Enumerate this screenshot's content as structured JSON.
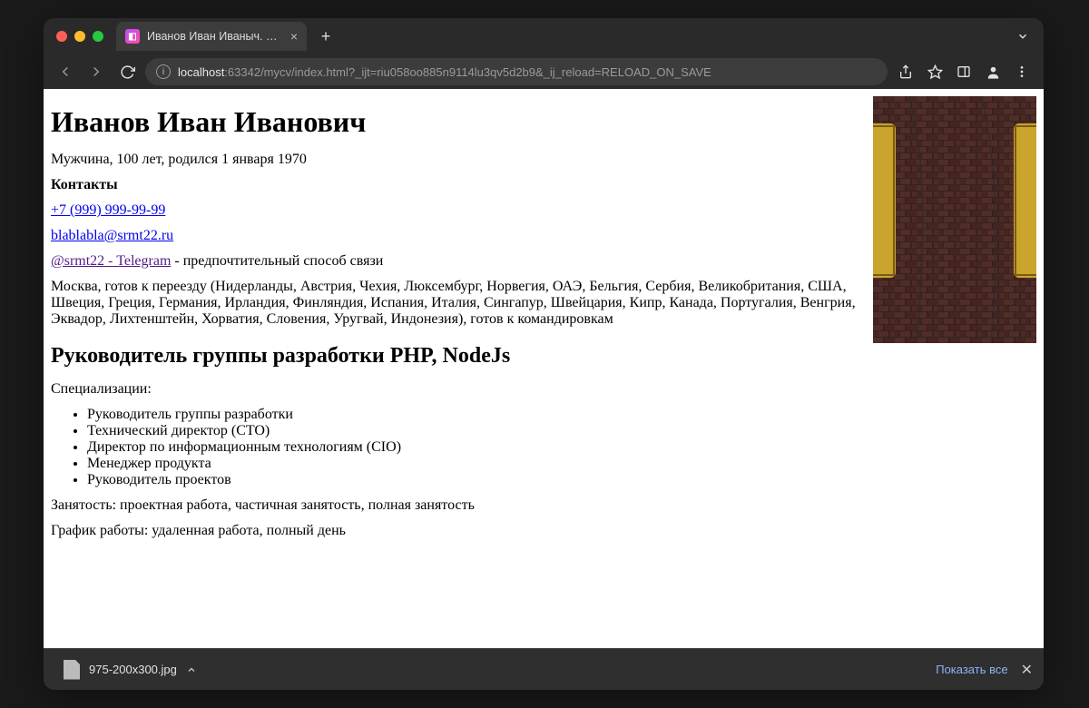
{
  "browser": {
    "tab_title": "Иванов Иван Иваныч. Резюме",
    "url_host": "localhost",
    "url_rest": ":63342/mycv/index.html?_ijt=riu058oo885n9114lu3qv5d2b9&_ij_reload=RELOAD_ON_SAVE"
  },
  "resume": {
    "name": "Иванов Иван Иванович",
    "personal": "Мужчина, 100 лет, родился 1 января 1970",
    "contacts_heading": "Контакты",
    "phone": "+7 (999) 999-99-99",
    "email": "blablabla@srmt22.ru",
    "telegram": "@srmt22 - Telegram",
    "telegram_note": " - предпочтительный способ связи",
    "location": "Москва, готов к переезду (Нидерланды, Австрия, Чехия, Люксембург, Норвегия, ОАЭ, Бельгия, Сербия, Великобритания, США, Швеция, Греция, Германия, Ирландия, Финляндия, Испания, Италия, Сингапур, Швейцария, Кипр, Канада, Португалия, Венгрия, Эквадор, Лихтенштейн, Хорватия, Словения, Уругвай, Индонезия), готов к командировкам",
    "title": "Руководитель группы разработки PHP, NodeJs",
    "spec_label": "Специализации:",
    "specializations": [
      "Руководитель группы разработки",
      "Технический директор (CTO)",
      "Директор по информационным технологиям (CIO)",
      "Менеджер продукта",
      "Руководитель проектов"
    ],
    "employment": "Занятость: проектная работа, частичная занятость, полная занятость",
    "schedule": "График работы: удаленная работа, полный день"
  },
  "downloads": {
    "filename": "975-200x300.jpg",
    "show_all": "Показать все"
  }
}
